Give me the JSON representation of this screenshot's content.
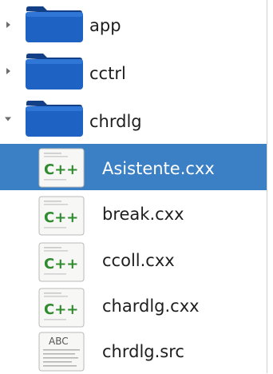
{
  "file_tree": {
    "items": [
      {
        "label": "app",
        "kind": "folder",
        "state": "collapsed",
        "selected": false,
        "icon": "folder-icon"
      },
      {
        "label": "cctrl",
        "kind": "folder",
        "state": "collapsed",
        "selected": false,
        "icon": "folder-icon"
      },
      {
        "label": "chrdlg",
        "kind": "folder",
        "state": "expanded",
        "selected": false,
        "icon": "folder-icon"
      },
      {
        "label": "Asistente.cxx",
        "kind": "file",
        "selected": true,
        "icon": "cpp-file-icon",
        "badge": "C++"
      },
      {
        "label": "break.cxx",
        "kind": "file",
        "selected": false,
        "icon": "cpp-file-icon",
        "badge": "C++"
      },
      {
        "label": "ccoll.cxx",
        "kind": "file",
        "selected": false,
        "icon": "cpp-file-icon",
        "badge": "C++"
      },
      {
        "label": "chardlg.cxx",
        "kind": "file",
        "selected": false,
        "icon": "cpp-file-icon",
        "badge": "C++"
      },
      {
        "label": "chrdlg.src",
        "kind": "file",
        "selected": false,
        "icon": "text-file-icon",
        "badge": "ABC"
      }
    ]
  },
  "colors": {
    "selection": "#3b7fc4",
    "folder": "#1e63c4",
    "cpp_badge": "#2e8b2e",
    "text": "#1e1e1e"
  }
}
